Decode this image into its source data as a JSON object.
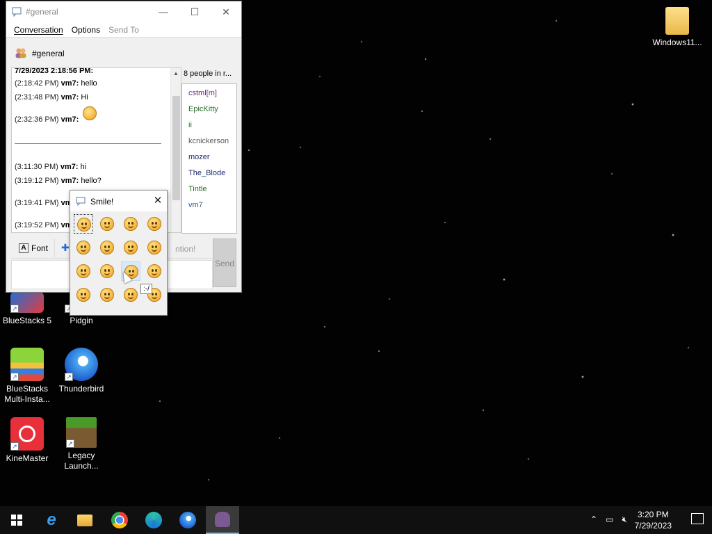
{
  "chat_window": {
    "title": "#general",
    "minimize": "—",
    "maximize": "☐",
    "close": "✕",
    "menus": [
      "Conversation",
      "Options",
      "Send To"
    ],
    "conversation_name": "#general",
    "messages": [
      {
        "time": "7/29/2023 2:18:56 PM:",
        "nick": "",
        "text": ""
      },
      {
        "time": "(2:18:42 PM)",
        "nick": "vm7:",
        "text": "hello"
      },
      {
        "time": "(2:31:48 PM)",
        "nick": "vm7:",
        "text": "Hi"
      },
      {
        "time": "(2:32:36 PM)",
        "nick": "vm7:",
        "text": ""
      },
      {
        "time": "(3:11:30 PM)",
        "nick": "vm7:",
        "text": "hi"
      },
      {
        "time": "(3:19:12 PM)",
        "nick": "vm7:",
        "text": "hello?"
      },
      {
        "time": "(3:19:41 PM)",
        "nick": "vm",
        "text": ""
      },
      {
        "time": "(3:19:52 PM)",
        "nick": "vm",
        "text": ""
      }
    ],
    "people_count": "8 people in r...",
    "people": [
      {
        "name": "cstml[m]",
        "color": "#6a2a8a"
      },
      {
        "name": "EpicKitty",
        "color": "#2a6a2a"
      },
      {
        "name": "ii",
        "color": "#2a6a2a"
      },
      {
        "name": "kcnickerson",
        "color": "#5a5a5a"
      },
      {
        "name": "mozer",
        "color": "#1a2a6a"
      },
      {
        "name": "The_Blode",
        "color": "#1a2a6a"
      },
      {
        "name": "Tintle",
        "color": "#2a6a2a"
      },
      {
        "name": "vm7",
        "color": "#2a5a8a"
      }
    ],
    "font_label": "Font",
    "insert_label": "I",
    "attention_label": "ntion!",
    "send_label": "Send"
  },
  "smiley_dialog": {
    "title": "Smile!",
    "close": "✕",
    "tooltip": ":-/",
    "smileys": [
      "smile",
      "grin",
      "sad",
      "wink",
      "tongue",
      "surprised",
      "kiss",
      "cool",
      "neutral",
      "crying",
      "uncertain",
      "angel",
      "shut-mouth",
      "embarrassed",
      "hmm",
      "confused"
    ]
  },
  "desktop_icons": [
    {
      "label": "Windows11...",
      "icon": "folder-icon"
    },
    {
      "label": "BlueStacks 5",
      "icon": "bluestacks-icon"
    },
    {
      "label": "Pidgin",
      "icon": "pidgin-icon"
    },
    {
      "label": "BlueStacks Multi-Insta...",
      "icon": "bluestacks-multi-icon"
    },
    {
      "label": "Thunderbird",
      "icon": "thunderbird-icon"
    },
    {
      "label": "KineMaster",
      "icon": "kinemaster-icon"
    },
    {
      "label": "Legacy Launch...",
      "icon": "minecraft-icon"
    }
  ],
  "taskbar": {
    "time": "3:20 PM",
    "date": "7/29/2023"
  }
}
